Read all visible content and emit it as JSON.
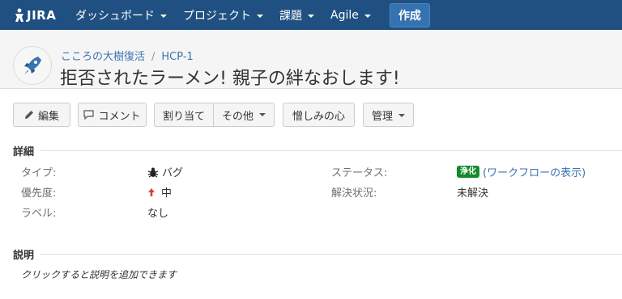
{
  "nav": {
    "logo_text": "JIRA",
    "items": [
      {
        "label": "ダッシュボード"
      },
      {
        "label": "プロジェクト"
      },
      {
        "label": "課題"
      },
      {
        "label": "Agile"
      }
    ],
    "create_label": "作成",
    "bar_color": "#205081"
  },
  "header": {
    "project_name": "こころの大樹復活",
    "issue_key": "HCP-1",
    "separator": "/",
    "summary": "拒否されたラーメン! 親子の絆なおします!"
  },
  "toolbar": {
    "edit_label": "編集",
    "comment_label": "コメント",
    "assign_label": "割り当て",
    "more_label": "その他",
    "transition_label": "憎しみの心",
    "admin_label": "管理"
  },
  "details": {
    "title": "詳細",
    "type_label": "タイプ:",
    "type_value": "バグ",
    "type_icon": "bug-icon",
    "priority_label": "優先度:",
    "priority_value": "中",
    "priority_icon": "arrow-up-icon",
    "labels_label": "ラベル:",
    "labels_value": "なし",
    "status_label": "ステータス:",
    "status_value": "浄化",
    "status_color": "#14892c",
    "workflow_link": "(ワークフローの表示)",
    "resolution_label": "解決状況:",
    "resolution_value": "未解決"
  },
  "description": {
    "title": "説明",
    "placeholder": "クリックすると説明を追加できます"
  }
}
